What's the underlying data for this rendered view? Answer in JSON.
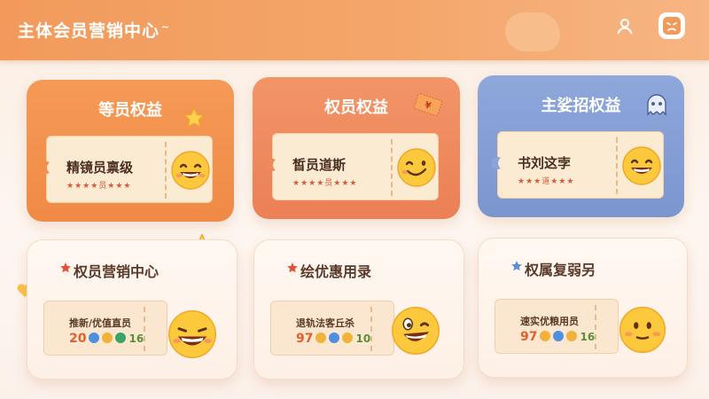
{
  "header": {
    "title": "主体会员营销中心",
    "title_mark": "~"
  },
  "icons": {
    "user": "user-icon",
    "face": "frown-face-icon"
  },
  "top_cards": [
    {
      "title": "等员权益",
      "ticket_title": "精镜员禀级",
      "ticket_stars": "★★★★员★★★",
      "accent": "#f59a56"
    },
    {
      "title": "权员权益",
      "ticket_title": "皙员道斯",
      "ticket_stars": "★★★★员★★★",
      "accent": "#f29568"
    },
    {
      "title": "主娑招权益",
      "ticket_title": "书刘这孛",
      "ticket_stars": "★★★道★★★",
      "accent": "#8ea8dc"
    }
  ],
  "bottom_cards": [
    {
      "title": "权员营销中心",
      "label": "推新/优值直员",
      "num": "20",
      "tail": "16",
      "star_color": "#e0503a"
    },
    {
      "title": "绘优惠用录",
      "label": "退轨法客丘杀",
      "num": "97",
      "tail": "10",
      "star_color": "#e0503a"
    },
    {
      "title": "权属复弱另",
      "label": "速实优粮用员",
      "num": "97",
      "tail": "16",
      "star_color": "#5a8fd0"
    }
  ],
  "colors": {
    "header_start": "#f29a5c",
    "card_orange": "#f08a46",
    "card_coral": "#ec7f55",
    "card_blue": "#7b95cf"
  }
}
